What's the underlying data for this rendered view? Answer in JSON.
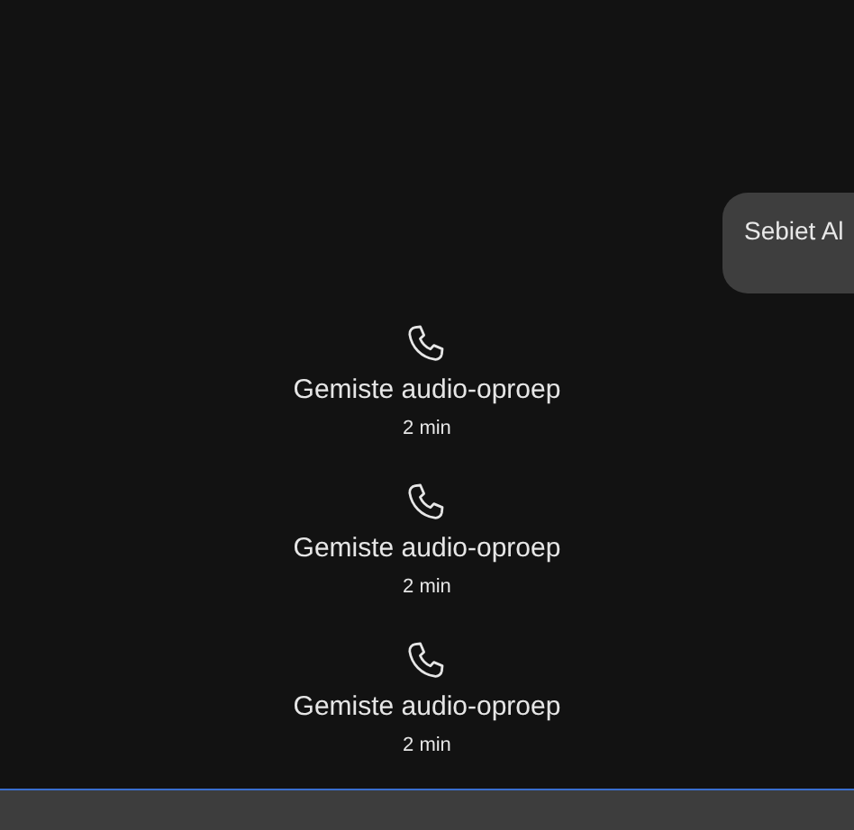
{
  "message": {
    "text": "Sebiet Al"
  },
  "calls": [
    {
      "title": "Gemiste audio-oproep",
      "time": "2 min"
    },
    {
      "title": "Gemiste audio-oproep",
      "time": "2 min"
    },
    {
      "title": "Gemiste audio-oproep",
      "time": "2 min"
    }
  ]
}
